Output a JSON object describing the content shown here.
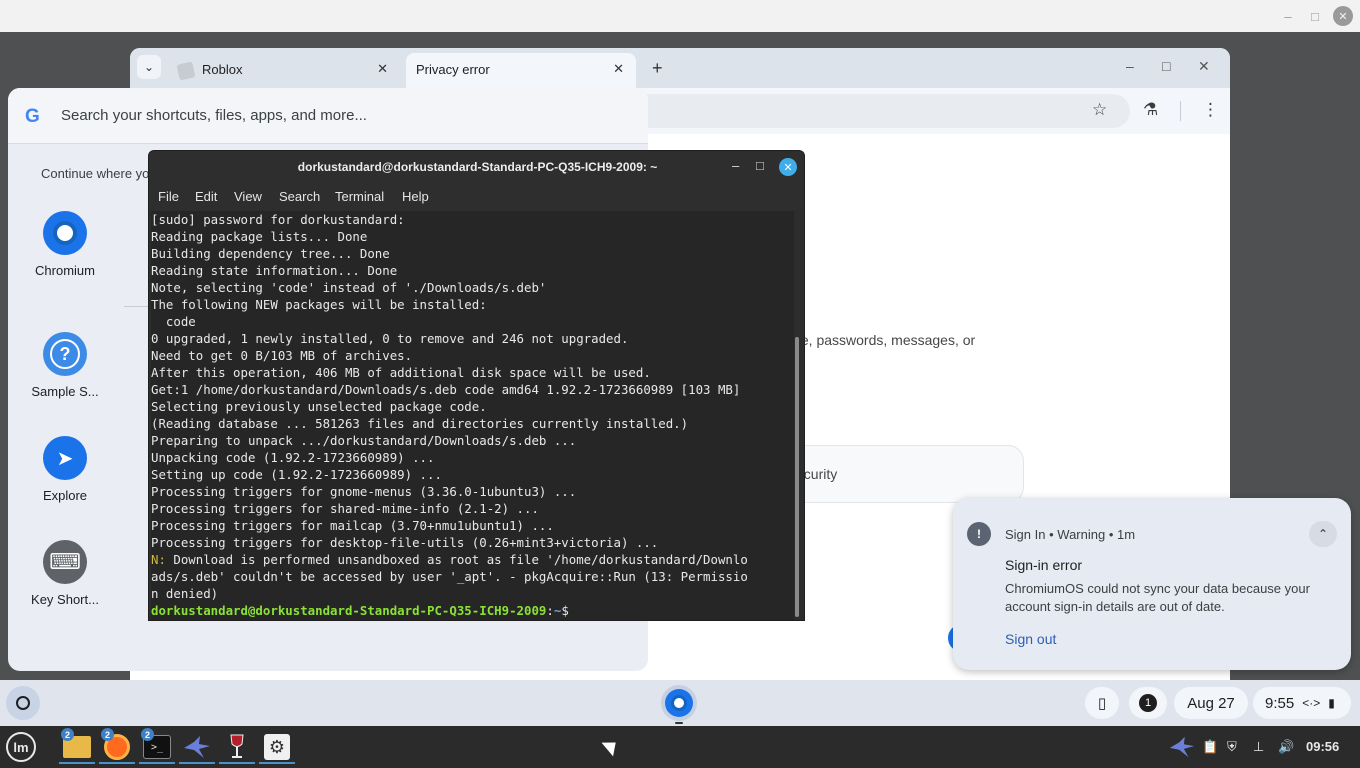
{
  "vm_window": {
    "min": "–",
    "max": "□",
    "close": "✕"
  },
  "browser": {
    "tab_search_icon": "⌄",
    "tabs": [
      {
        "title": "Roblox",
        "close": "✕"
      },
      {
        "title": "Privacy error",
        "close": "✕"
      }
    ],
    "new_tab": "+",
    "window_controls": {
      "min": "–",
      "max": "□",
      "close": "✕"
    },
    "toolbar_icons": {
      "star": "☆",
      "labs": "⚗",
      "menu": "⋮"
    },
    "page_fragments": {
      "text": "ple, passwords, messages, or",
      "box_text": "ecurity"
    }
  },
  "launcher": {
    "search_placeholder": "Search your shortcuts, files, apps, and more...",
    "google_logo": "G",
    "continue_text": "Continue where yo",
    "apps": [
      {
        "label": "Chromium",
        "icon": "chromium-icon"
      },
      {
        "label": "Sample S...",
        "icon": "help-icon",
        "glyph": "?"
      },
      {
        "label": "Explore",
        "icon": "explore-icon",
        "glyph": "➤"
      },
      {
        "label": "Key Short...",
        "icon": "keyboard-icon",
        "glyph": "⌨"
      }
    ]
  },
  "terminal": {
    "title": "dorkustandard@dorkustandard-Standard-PC-Q35-ICH9-2009: ~",
    "controls": {
      "min": "–",
      "max": "□",
      "close": "✕"
    },
    "menu": [
      "File",
      "Edit",
      "View",
      "Search",
      "Terminal",
      "Help"
    ],
    "lines": [
      "[sudo] password for dorkustandard:",
      "Reading package lists... Done",
      "Building dependency tree... Done",
      "Reading state information... Done",
      "Note, selecting 'code' instead of './Downloads/s.deb'",
      "The following NEW packages will be installed:",
      "  code",
      "0 upgraded, 1 newly installed, 0 to remove and 246 not upgraded.",
      "Need to get 0 B/103 MB of archives.",
      "After this operation, 406 MB of additional disk space will be used.",
      "Get:1 /home/dorkustandard/Downloads/s.deb code amd64 1.92.2-1723660989 [103 MB]",
      "Selecting previously unselected package code.",
      "(Reading database ... 581263 files and directories currently installed.)",
      "Preparing to unpack .../dorkustandard/Downloads/s.deb ...",
      "Unpacking code (1.92.2-1723660989) ...",
      "Setting up code (1.92.2-1723660989) ...",
      "Processing triggers for gnome-menus (3.36.0-1ubuntu3) ...",
      "Processing triggers for shared-mime-info (2.1-2) ...",
      "Processing triggers for mailcap (3.70+nmu1ubuntu1) ...",
      "Processing triggers for desktop-file-utils (0.26+mint3+victoria) ..."
    ],
    "note_prefix": "N:",
    "note_lines": [
      " Download is performed unsandboxed as root as file '/home/dorkustandard/Downlo",
      "ads/s.deb' couldn't be accessed by user '_apt'. - pkgAcquire::Run (13: Permissio",
      "n denied)"
    ],
    "prompt_user": "dorkustandard@dorkustandard-Standard-PC-Q35-ICH9-2009",
    "prompt_sep": ":",
    "prompt_path": "~",
    "prompt_symbol": "$"
  },
  "notification": {
    "icon_glyph": "!",
    "source": "Sign In",
    "severity": "Warning",
    "age": "1m",
    "collapse_icon": "⌃",
    "title": "Sign-in error",
    "body": "ChromiumOS could not sync your data because your account sign-in details are out of date.",
    "action": "Sign out"
  },
  "shelf": {
    "phone_icon": "▯",
    "notification_count": "1",
    "date": "Aug 27",
    "time": "9:55",
    "network_icon": "<·>",
    "battery_icon": "▮"
  },
  "mint_panel": {
    "menu_glyph": "lm",
    "apps": [
      {
        "name": "files",
        "badge": "2"
      },
      {
        "name": "firefox",
        "badge": "2"
      },
      {
        "name": "terminal",
        "badge": "2"
      },
      {
        "name": "bird"
      },
      {
        "name": "wine"
      },
      {
        "name": "settings"
      }
    ],
    "terminal_glyph": ">_",
    "settings_glyph": "⚙",
    "tray_icons": {
      "clipboard": "📋",
      "shield": "⛨",
      "network": "⊥",
      "volume": "🔊"
    },
    "clock": "09:56"
  },
  "colors": {
    "accent": "#1a73e8",
    "terminal_bg": "#262626",
    "prompt_green": "#8ae234",
    "note_yellow": "#d4b73b"
  }
}
